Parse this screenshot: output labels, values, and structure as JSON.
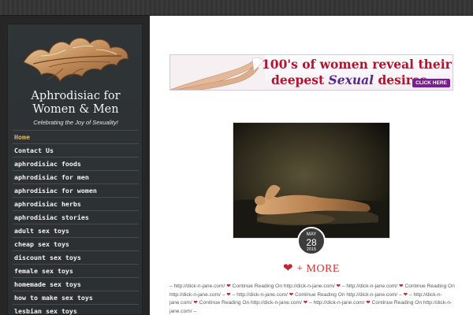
{
  "site": {
    "title_line1": "Aphrodisiac for",
    "title_line2": "Women & Men",
    "tagline": "Celebrating the Joy of Sexuality!"
  },
  "menu": [
    {
      "label": "Home",
      "active": true
    },
    {
      "label": "Contact Us"
    },
    {
      "label": "aphrodisiac foods"
    },
    {
      "label": "aphrodisiac for men"
    },
    {
      "label": "aphrodisiac for women"
    },
    {
      "label": "aphrodisiac herbs"
    },
    {
      "label": "aphrodisiac stories"
    },
    {
      "label": "adult sex toys"
    },
    {
      "label": "cheap sex toys"
    },
    {
      "label": "discount sex toys"
    },
    {
      "label": "female sex toys"
    },
    {
      "label": "homemade sex toys"
    },
    {
      "label": "how to make sex toys"
    },
    {
      "label": "lesbian sex toys"
    }
  ],
  "banner": {
    "line1": "100's of women reveal their",
    "line2_prefix": "deepest ",
    "line2_em": "Sexual",
    "line2_suffix": " desires",
    "button": "CLICK HERE"
  },
  "post": {
    "date_month": "MAY",
    "date_day": "28",
    "date_year": "2015",
    "title": "+ MORE",
    "heart": "❤",
    "excerpt": "– http://dick-n-jane.com/ ❤ Continue Reading On http://dick-n-jane.com/ ❤ – http://dick-n-jane.com/ ❤ Continue Reading On http://dick-n-jane.com/ – ❤ – http://dick-n-jane.com/ ❤ Continue Reading On http://dick-n-jane.com/ – ❤ – http://dick-n-jane.com/ ❤ Continue Reading On http://dick-n-jane.com/ ❤ – http://dick-n-jane.com/ ❤ Continue Reading On http://dick-n-jane.com/ –"
  },
  "colors": {
    "accent_heart": "#c0282d",
    "menu_active": "#d9b56a",
    "banner_red": "#b0142e"
  }
}
